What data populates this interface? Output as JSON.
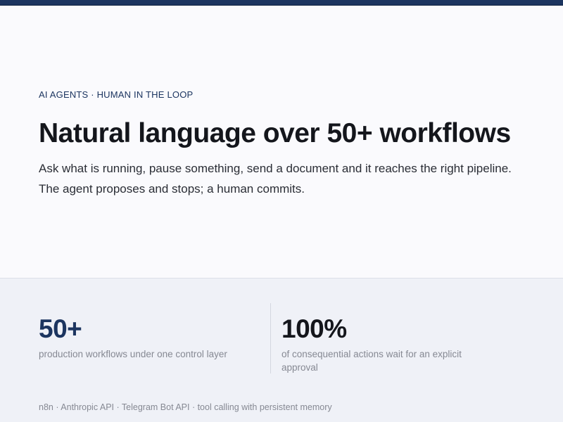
{
  "hero": {
    "eyebrow": "AI AGENTS · HUMAN IN THE LOOP",
    "title": "Natural language over 50+ workflows",
    "subtitle": "Ask what is running, pause something, send a document and it reaches the right pipeline. The agent proposes and stops; a human commits."
  },
  "stats": [
    {
      "value": "50+",
      "description": "production workflows under one control layer"
    },
    {
      "value": "100%",
      "description": "of consequential actions wait for an explicit approval"
    }
  ],
  "tech_stack": "n8n · Anthropic API · Telegram Bot API · tool calling with persistent memory",
  "colors": {
    "accent": "#1c3560",
    "text": "#14161c",
    "muted": "#868993",
    "band": "#eff1f7"
  }
}
